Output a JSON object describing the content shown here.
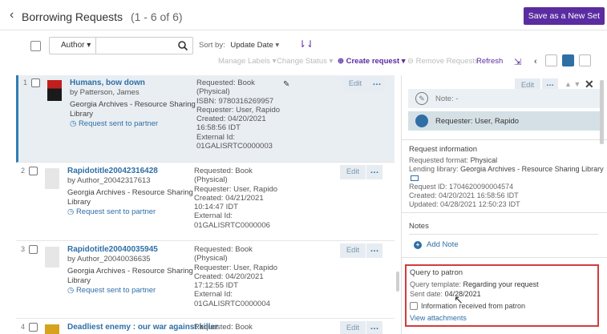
{
  "header": {
    "title": "Borrowing Requests",
    "count": "(1 - 6 of 6)",
    "save_set_label": "Save as a New Set"
  },
  "toolbar": {
    "search_scope": "Author",
    "search_placeholder": "",
    "sort_by_label": "Sort by:",
    "sort_by_value": "Update Date",
    "manage_labels": "Manage Labels",
    "change_status": "Change Status",
    "create_request": "Create request",
    "remove_requests": "Remove Requests",
    "refresh": "Refresh"
  },
  "items": [
    {
      "num": "1",
      "title": "Humans, bow down",
      "author": "by Patterson, James",
      "library": "Georgia Archives - Resource Sharing Library",
      "status": "Request sent to partner",
      "requested": "Requested: Book",
      "requested2": "(Physical)",
      "isbn": "ISBN: 9780316269957",
      "requester": "Requester: User, Rapido",
      "created": "Created: 04/20/2021",
      "created2": "16:58:56 IDT",
      "ext_label": "External Id:",
      "ext_id": "01GALISRTC0000003",
      "edit": "Edit",
      "more": "…"
    },
    {
      "num": "2",
      "title": "Rapidotitle20042316428",
      "author": "by Author_20042317613",
      "library": "Georgia Archives - Resource Sharing Library",
      "status": "Request sent to partner",
      "requested": "Requested: Book",
      "requested2": "(Physical)",
      "requester": "Requester: User, Rapido",
      "created": "Created: 04/21/2021",
      "created2": "10:14:47 IDT",
      "ext_label": "External Id:",
      "ext_id": "01GALISRTC0000006",
      "edit": "Edit",
      "more": "…"
    },
    {
      "num": "3",
      "title": "Rapidotitle20040035945",
      "author": "by Author_20040036635",
      "library": "Georgia Archives - Resource Sharing Library",
      "status": "Request sent to partner",
      "requested": "Requested: Book",
      "requested2": "(Physical)",
      "requester": "Requester: User, Rapido",
      "created": "Created: 04/20/2021",
      "created2": "17:12:55 IDT",
      "ext_label": "External Id:",
      "ext_id": "01GALISRTC0000004",
      "edit": "Edit",
      "more": "…"
    },
    {
      "num": "4",
      "title": "Deadliest enemy : our war against killer",
      "requested": "Requested: Book",
      "edit": "Edit",
      "more": "…"
    }
  ],
  "panel": {
    "edit": "Edit",
    "more": "…",
    "note": "Note: -",
    "requester": "Requester: User, Rapido",
    "request_info_title": "Request information",
    "requested_format_label": "Requested format:",
    "requested_format": "Physical",
    "lending_library_label": "Lending library:",
    "lending_library": "Georgia Archives - Resource Sharing Library",
    "request_id": "Request ID: 1704620090004574",
    "created": "Created: 04/20/2021 16:58:56 IDT",
    "updated": "Updated: 04/28/2021 12:50:23 IDT",
    "notes_title": "Notes",
    "add_note": "Add Note",
    "query_title": "Query to patron",
    "query_template_label": "Query template:",
    "query_template": "Regarding your request",
    "sent_date_label": "Sent date:",
    "sent_date": "04/28/2021",
    "info_received": "Information received from patron",
    "view_attachments": "View attachments"
  },
  "colors": {
    "accent": "#5b2ca1",
    "link": "#2f6fa6",
    "highlight_border": "#d23c3c"
  }
}
